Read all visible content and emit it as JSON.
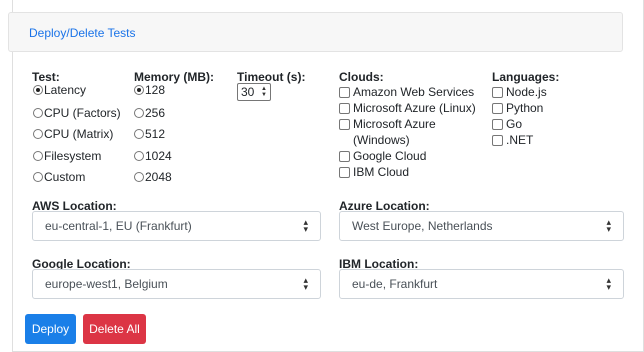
{
  "header": {
    "title": "Deploy/Delete Tests"
  },
  "test": {
    "label": "Test:",
    "options": [
      "Latency",
      "CPU (Factors)",
      "CPU (Matrix)",
      "Filesystem",
      "Custom"
    ],
    "selected": "Latency"
  },
  "memory": {
    "label": "Memory (MB):",
    "options": [
      "128",
      "256",
      "512",
      "1024",
      "2048"
    ],
    "selected": "128"
  },
  "timeout": {
    "label": "Timeout (s):",
    "value": "30"
  },
  "clouds": {
    "label": "Clouds:",
    "options": [
      "Amazon Web Services",
      "Microsoft Azure (Linux)",
      "Microsoft Azure",
      "(Windows)",
      "Google Cloud",
      "IBM Cloud"
    ]
  },
  "languages": {
    "label": "Languages:",
    "options": [
      "Node.js",
      "Python",
      "Go",
      ".NET"
    ]
  },
  "aws": {
    "label": "AWS Location:",
    "value": "eu-central-1, EU (Frankfurt)"
  },
  "azure": {
    "label": "Azure Location:",
    "value": "West Europe, Netherlands"
  },
  "google": {
    "label": "Google Location:",
    "value": "europe-west1, Belgium"
  },
  "ibm": {
    "label": "IBM Location:",
    "value": "eu-de, Frankfurt"
  },
  "buttons": {
    "deploy": "Deploy",
    "delete_all": "Delete All"
  },
  "colors": {
    "primary": "#1a7fe8",
    "danger": "#dc3545",
    "link": "#1a73e8"
  }
}
